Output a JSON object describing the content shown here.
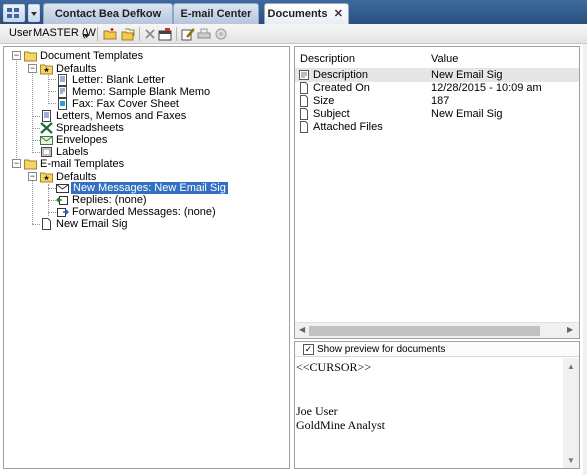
{
  "tabs": [
    {
      "label": "Contact Bea Defkow",
      "active": false,
      "closable": false
    },
    {
      "label": "E-mail Center",
      "active": false,
      "closable": false
    },
    {
      "label": "Documents",
      "active": true,
      "closable": true
    }
  ],
  "toolbar": {
    "user_label": "User",
    "user_value": "MASTER (W",
    "icons": [
      "new-folder-icon",
      "copy-folder-icon",
      "delete-icon",
      "properties-icon",
      "edit-icon",
      "print-icon",
      "merge-icon"
    ]
  },
  "tree": {
    "document_templates": "Document Templates",
    "defaults_1": "Defaults",
    "letter": "Letter: Blank Letter",
    "memo": "Memo: Sample Blank Memo",
    "fax": "Fax: Fax Cover Sheet",
    "letters_memos_faxes": "Letters, Memos and Faxes",
    "spreadsheets": "Spreadsheets",
    "envelopes": "Envelopes",
    "labels": "Labels",
    "email_templates": "E-mail Templates",
    "defaults_2": "Defaults",
    "new_messages": "New Messages: New Email Sig",
    "replies": "Replies: (none)",
    "forwarded": "Forwarded Messages: (none)",
    "new_email_sig": "New Email Sig"
  },
  "properties": {
    "col_description": "Description",
    "col_value": "Value",
    "rows": [
      {
        "name": "Description",
        "value": "New Email Sig"
      },
      {
        "name": "Created On",
        "value": "12/28/2015 - 10:09 am"
      },
      {
        "name": "Size",
        "value": "187"
      },
      {
        "name": "Subject",
        "value": "New Email Sig"
      },
      {
        "name": "Attached Files",
        "value": ""
      }
    ]
  },
  "preview": {
    "checkbox_label": "Show preview for documents",
    "checked": true,
    "line1": "<<CURSOR>>",
    "line2": "Joe User",
    "line3": "GoldMine Analyst"
  }
}
